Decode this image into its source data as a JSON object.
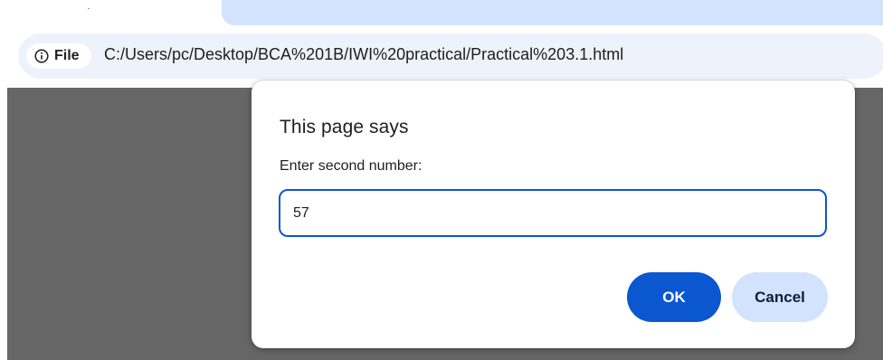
{
  "browser": {
    "site_chip_label": "File",
    "url": "C:/Users/pc/Desktop/BCA%201B/IWI%20practical/Practical%203.1.html"
  },
  "dialog": {
    "title": "This page says",
    "message": "Enter second number:",
    "input_value": "57",
    "ok_label": "OK",
    "cancel_label": "Cancel"
  },
  "colors": {
    "accent": "#0b57d0",
    "secondary_button": "#d3e3fd",
    "page_background": "#666666"
  },
  "icons": {
    "site_info": "info-circle-icon"
  }
}
